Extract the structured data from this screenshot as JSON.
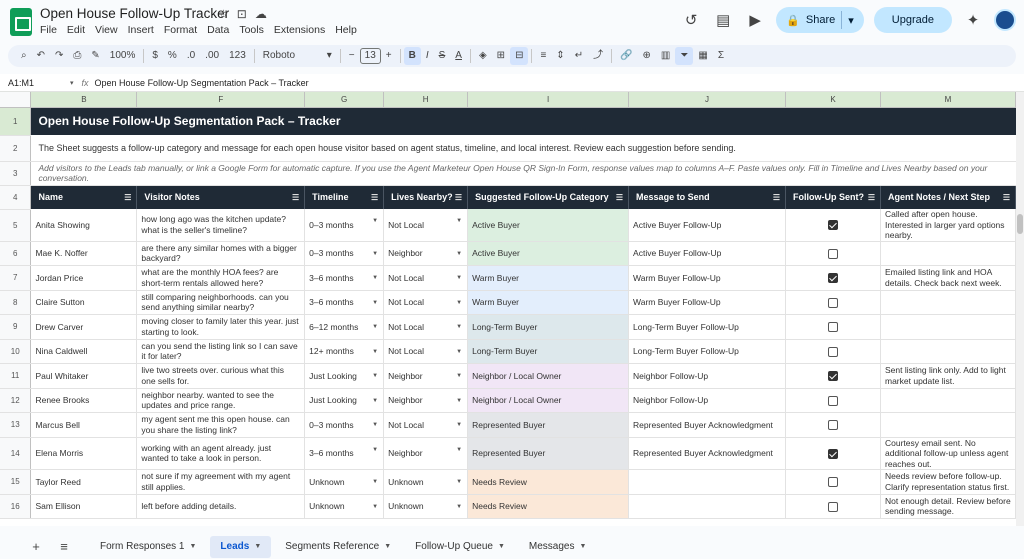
{
  "app": {
    "doc_title": "Open House Follow-Up Tracker",
    "menu": [
      "File",
      "Edit",
      "View",
      "Insert",
      "Format",
      "Data",
      "Tools",
      "Extensions",
      "Help"
    ],
    "share_label": "Share",
    "upgrade_label": "Upgrade"
  },
  "toolbar": {
    "zoom": "100%",
    "currency": "$",
    "percent": "%",
    "decimal_dec": ".0",
    "decimal_inc": ".00",
    "number_format": "123",
    "font": "Roboto",
    "font_size": "13",
    "bold": "B",
    "italic": "I",
    "strike": "S",
    "text_color": "A",
    "sigma": "Σ"
  },
  "formula_bar": {
    "cell_ref": "A1:M1",
    "fx": "fx",
    "content": "Open House Follow-Up Segmentation Pack – Tracker"
  },
  "columns": [
    "B",
    "F",
    "G",
    "H",
    "I",
    "J",
    "K",
    "M"
  ],
  "row_numbers": [
    "1",
    "2",
    "3",
    "4",
    "5",
    "6",
    "7",
    "8",
    "9",
    "10",
    "11",
    "12",
    "13",
    "14",
    "15",
    "16"
  ],
  "title_row": "Open House Follow-Up Segmentation Pack – Tracker",
  "desc_row": "The Sheet suggests a follow-up category and message for each open house visitor based on agent status, timeline, and local interest. Review each suggestion before sending.",
  "note_row": "Add visitors to the Leads tab manually, or link a Google Form for automatic capture. If you use the Agent Marketeur Open House QR Sign-In Form, response values map to columns A–F. Paste values only. Fill in Timeline and Lives Nearby based on your conversation.",
  "headers": [
    "Name",
    "Visitor Notes",
    "Timeline",
    "Lives Nearby?",
    "Suggested Follow-Up Category",
    "Message to Send",
    "Follow-Up Sent?",
    "Agent Notes / Next Step"
  ],
  "rows": [
    {
      "name": "Anita Showing",
      "notes": "how long ago was the kitchen update? what is the seller's timeline?",
      "timeline": "0–3 months",
      "nearby": "Not Local",
      "category": "Active Buyer",
      "cat_color": "#dcefe0",
      "message": "Active Buyer Follow-Up",
      "sent": true,
      "agent_notes": "Called after open house. Interested in larger yard options nearby."
    },
    {
      "name": "Mae K. Noffer",
      "notes": "are there any similar homes with a bigger backyard?",
      "timeline": "0–3 months",
      "nearby": "Neighbor",
      "category": "Active Buyer",
      "cat_color": "#dcefe0",
      "message": "Active Buyer Follow-Up",
      "sent": false,
      "agent_notes": ""
    },
    {
      "name": "Jordan Price",
      "notes": "what are the monthly HOA fees? are short-term rentals allowed here?",
      "timeline": "3–6 months",
      "nearby": "Not Local",
      "category": "Warm Buyer",
      "cat_color": "#e3eefc",
      "message": "Warm Buyer Follow-Up",
      "sent": true,
      "agent_notes": "Emailed listing link and HOA details. Check back next week."
    },
    {
      "name": "Claire Sutton",
      "notes": "still comparing neighborhoods. can you send anything similar nearby?",
      "timeline": "3–6 months",
      "nearby": "Not Local",
      "category": "Warm Buyer",
      "cat_color": "#e3eefc",
      "message": "Warm Buyer Follow-Up",
      "sent": false,
      "agent_notes": ""
    },
    {
      "name": "Drew Carver",
      "notes": "moving closer to family later this year. just starting to look.",
      "timeline": "6–12 months",
      "nearby": "Not Local",
      "category": "Long-Term Buyer",
      "cat_color": "#dde8ec",
      "message": "Long-Term Buyer Follow-Up",
      "sent": false,
      "agent_notes": ""
    },
    {
      "name": "Nina Caldwell",
      "notes": "can you send the listing link so I can save it for later?",
      "timeline": "12+ months",
      "nearby": "Not Local",
      "category": "Long-Term Buyer",
      "cat_color": "#dde8ec",
      "message": "Long-Term Buyer Follow-Up",
      "sent": false,
      "agent_notes": ""
    },
    {
      "name": "Paul Whitaker",
      "notes": "live two streets over. curious what this one sells for.",
      "timeline": "Just Looking",
      "nearby": "Neighbor",
      "category": "Neighbor / Local Owner",
      "cat_color": "#f1e6f6",
      "message": "Neighbor Follow-Up",
      "sent": true,
      "agent_notes": "Sent listing link only. Add to light market update list."
    },
    {
      "name": "Renee Brooks",
      "notes": "neighbor nearby. wanted to see the updates and price range.",
      "timeline": "Just Looking",
      "nearby": "Neighbor",
      "category": "Neighbor / Local Owner",
      "cat_color": "#f1e6f6",
      "message": "Neighbor Follow-Up",
      "sent": false,
      "agent_notes": ""
    },
    {
      "name": "Marcus Bell",
      "notes": "my agent sent me this open house. can you share the listing link?",
      "timeline": "0–3 months",
      "nearby": "Not Local",
      "category": "Represented Buyer",
      "cat_color": "#e4e6e9",
      "message": "Represented Buyer Acknowledgment",
      "sent": false,
      "agent_notes": ""
    },
    {
      "name": "Elena Morris",
      "notes": "working with an agent already. just wanted to take a look in person.",
      "timeline": "3–6 months",
      "nearby": "Neighbor",
      "category": "Represented Buyer",
      "cat_color": "#e4e6e9",
      "message": "Represented Buyer Acknowledgment",
      "sent": true,
      "agent_notes": "Courtesy email sent. No additional follow-up unless agent reaches out."
    },
    {
      "name": "Taylor Reed",
      "notes": "not sure if my agreement with my agent still applies.",
      "timeline": "Unknown",
      "nearby": "Unknown",
      "category": "Needs Review",
      "cat_color": "#fbe8d8",
      "message": "",
      "sent": false,
      "agent_notes": "Needs review before follow-up. Clarify representation status first."
    },
    {
      "name": "Sam Ellison",
      "notes": "left before adding details.",
      "timeline": "Unknown",
      "nearby": "Unknown",
      "category": "Needs Review",
      "cat_color": "#fbe8d8",
      "message": "",
      "sent": false,
      "agent_notes": "Not enough detail. Review before sending message."
    }
  ],
  "tabs": [
    {
      "label": "Form Responses 1",
      "active": false
    },
    {
      "label": "Leads",
      "active": true
    },
    {
      "label": "Segments Reference",
      "active": false
    },
    {
      "label": "Follow-Up Queue",
      "active": false
    },
    {
      "label": "Messages",
      "active": false
    }
  ]
}
